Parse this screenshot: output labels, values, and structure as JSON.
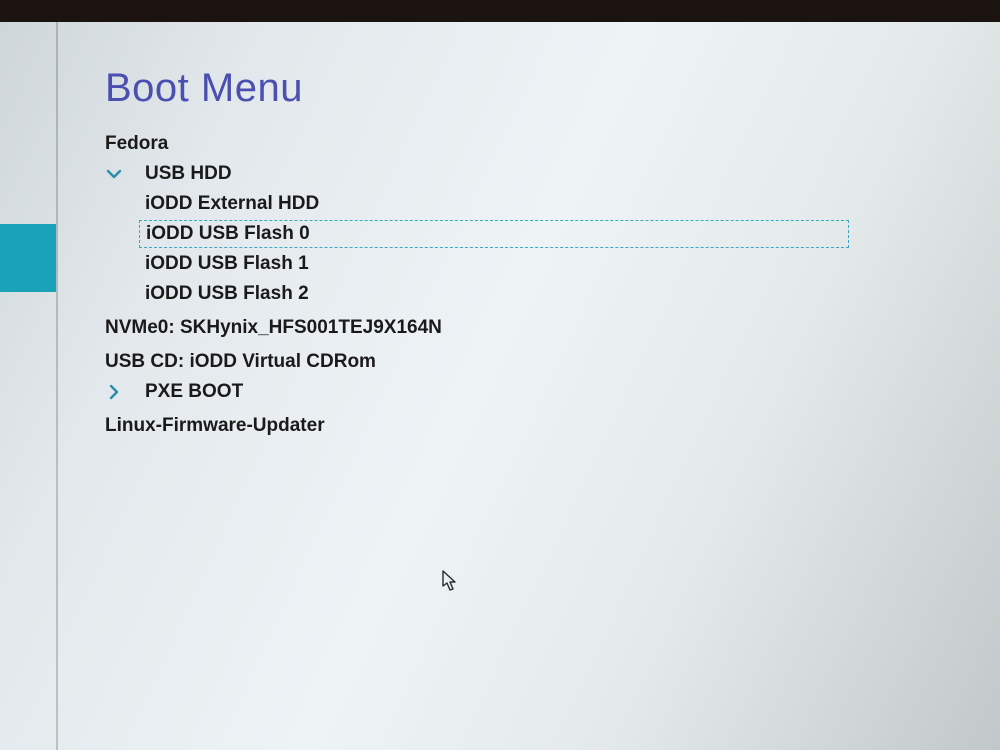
{
  "title": "Boot Menu",
  "items": {
    "fedora": "Fedora",
    "usb_hdd_group": "USB HDD",
    "usb_hdd_children": {
      "c0": "iODD External HDD",
      "c1": "iODD USB Flash 0",
      "c2": "iODD USB Flash 1",
      "c3": "iODD USB Flash 2"
    },
    "nvme0": "NVMe0: SKHynix_HFS001TEJ9X164N",
    "usbcd": "USB CD: iODD Virtual CDRom",
    "pxe_group": "PXE BOOT",
    "linux_fw": "Linux-Firmware-Updater"
  },
  "selected_child_key": "c1",
  "colors": {
    "title": "#4b4fb0",
    "tab_active": "#1aa3b8",
    "arrow": "#2b8ea8",
    "selected_border": "#3ba7c4"
  }
}
